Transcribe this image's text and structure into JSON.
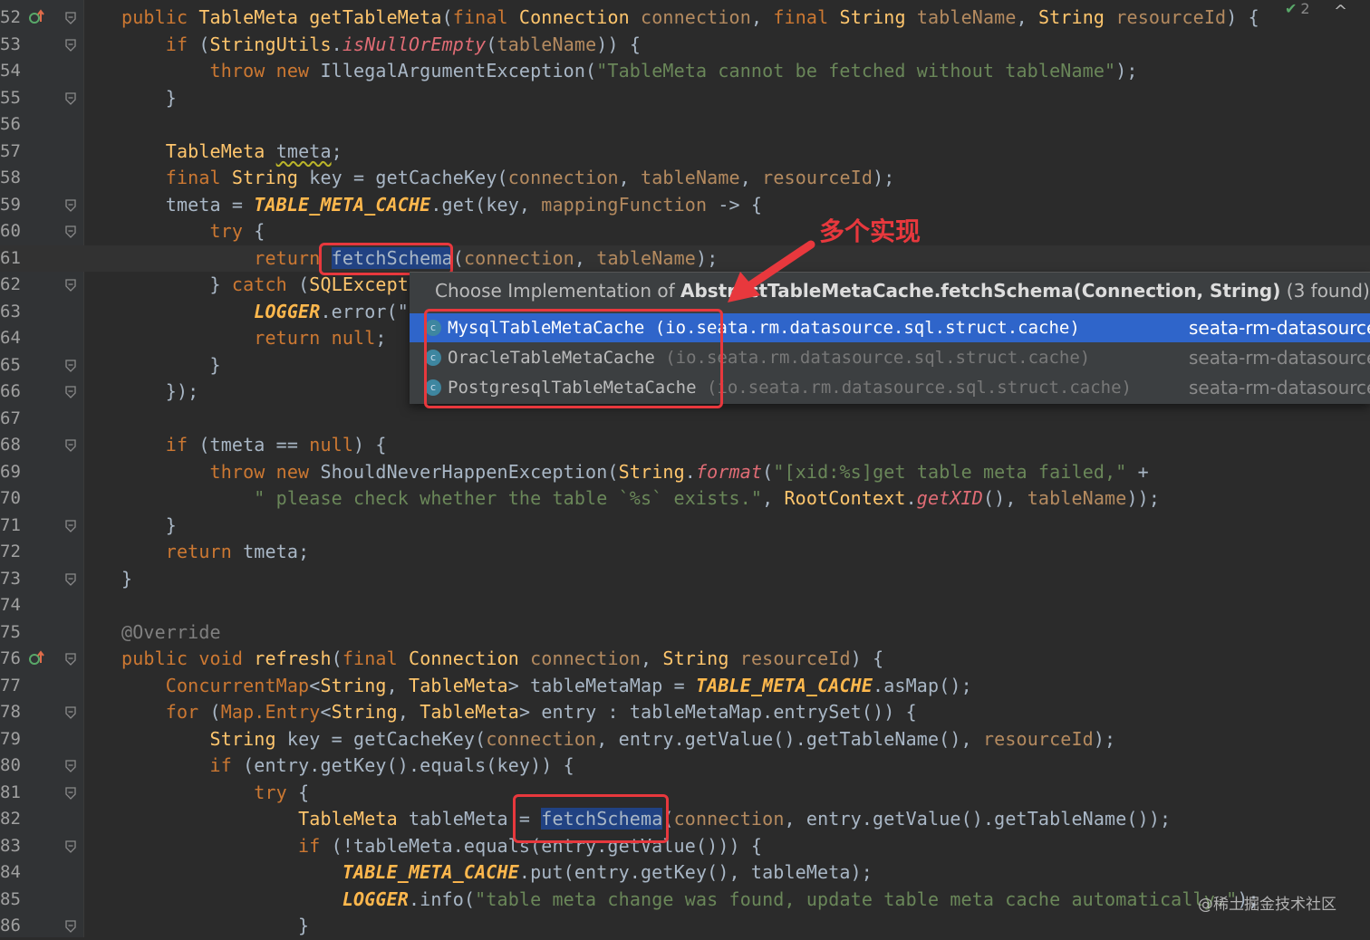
{
  "editor": {
    "lines": [
      {
        "num": "52",
        "marker": "override-up",
        "tokens": [
          [
            "public ",
            "kw"
          ],
          [
            "TableMeta ",
            "type"
          ],
          [
            "getTableMeta",
            "fn"
          ],
          [
            "(",
            "p"
          ],
          [
            "final ",
            "kw"
          ],
          [
            "Connection ",
            "type"
          ],
          [
            "connection",
            "param"
          ],
          [
            ", ",
            "p"
          ],
          [
            "final ",
            "kw"
          ],
          [
            "String ",
            "type"
          ],
          [
            "tableName",
            "param"
          ],
          [
            ", ",
            "p"
          ],
          [
            "String ",
            "type"
          ],
          [
            "resourceId",
            "param"
          ],
          [
            ") {",
            "p"
          ]
        ]
      },
      {
        "num": "53",
        "tokens": [
          [
            "    if ",
            "kw"
          ],
          [
            "(",
            "p"
          ],
          [
            "StringUtils",
            "type"
          ],
          [
            ".",
            "p"
          ],
          [
            "isNullOrEmpty",
            "staticm"
          ],
          [
            "(",
            "p"
          ],
          [
            "tableName",
            "param"
          ],
          [
            ")) {",
            "p"
          ]
        ]
      },
      {
        "num": "54",
        "tokens": [
          [
            "        throw new ",
            "kw"
          ],
          [
            "IllegalArgumentException(",
            "p"
          ],
          [
            "\"TableMeta cannot be fetched without tableName\"",
            "str"
          ],
          [
            ");",
            "p"
          ]
        ]
      },
      {
        "num": "55",
        "tokens": [
          [
            "    }",
            "p"
          ]
        ]
      },
      {
        "num": "56",
        "tokens": []
      },
      {
        "num": "57",
        "tokens": [
          [
            "    ",
            "p"
          ],
          [
            "TableMeta ",
            "type"
          ],
          [
            "tmeta",
            "sq"
          ],
          [
            ";",
            "p"
          ]
        ]
      },
      {
        "num": "58",
        "tokens": [
          [
            "    final ",
            "kw"
          ],
          [
            "String ",
            "type"
          ],
          [
            "key = getCacheKey(",
            "p"
          ],
          [
            "connection",
            "param"
          ],
          [
            ", ",
            "p"
          ],
          [
            "tableName",
            "param"
          ],
          [
            ", ",
            "p"
          ],
          [
            "resourceId",
            "param"
          ],
          [
            ");",
            "p"
          ]
        ]
      },
      {
        "num": "59",
        "tokens": [
          [
            "    tmeta = ",
            "p"
          ],
          [
            "TABLE_META_CACHE",
            "staticfld"
          ],
          [
            ".get(key, ",
            "p"
          ],
          [
            "mappingFunction",
            "param"
          ],
          [
            " -> {",
            "p"
          ]
        ]
      },
      {
        "num": "60",
        "tokens": [
          [
            "        try ",
            "kw"
          ],
          [
            "{",
            "p"
          ]
        ]
      },
      {
        "num": "61",
        "current": true,
        "tokens": [
          [
            "            return ",
            "kw"
          ],
          [
            "fetchSchema",
            "sel"
          ],
          [
            "(",
            "p"
          ],
          [
            "connection",
            "param"
          ],
          [
            ", ",
            "p"
          ],
          [
            "tableName",
            "param"
          ],
          [
            ");",
            "p"
          ]
        ]
      },
      {
        "num": "62",
        "tokens": [
          [
            "        } ",
            "p"
          ],
          [
            "catch ",
            "kw"
          ],
          [
            "(",
            "p"
          ],
          [
            "SQLExcepti",
            "type"
          ]
        ]
      },
      {
        "num": "63",
        "tokens": [
          [
            "            ",
            "p"
          ],
          [
            "LOGGER",
            "staticfld"
          ],
          [
            ".error(\"g",
            "p"
          ]
        ]
      },
      {
        "num": "64",
        "tokens": [
          [
            "            return null",
            "kw"
          ],
          [
            ";",
            "p"
          ]
        ]
      },
      {
        "num": "65",
        "tokens": [
          [
            "        }",
            "p"
          ]
        ]
      },
      {
        "num": "66",
        "tokens": [
          [
            "    });",
            "p"
          ]
        ]
      },
      {
        "num": "67",
        "tokens": []
      },
      {
        "num": "68",
        "tokens": [
          [
            "    if ",
            "kw"
          ],
          [
            "(tmeta == ",
            "p"
          ],
          [
            "null",
            "kw"
          ],
          [
            ") {",
            "p"
          ]
        ]
      },
      {
        "num": "69",
        "tokens": [
          [
            "        throw new ",
            "kw"
          ],
          [
            "ShouldNeverHappenException(",
            "p"
          ],
          [
            "String",
            "type"
          ],
          [
            ".",
            "p"
          ],
          [
            "format",
            "staticm"
          ],
          [
            "(",
            "p"
          ],
          [
            "\"[xid:%s]get table meta failed,\"",
            "str"
          ],
          [
            " +",
            "p"
          ]
        ]
      },
      {
        "num": "70",
        "tokens": [
          [
            "            ",
            "p"
          ],
          [
            "\" please check whether the table `%s` exists.\"",
            "str"
          ],
          [
            ", ",
            "p"
          ],
          [
            "RootContext",
            "type"
          ],
          [
            ".",
            "p"
          ],
          [
            "getXID",
            "staticm"
          ],
          [
            "(), ",
            "p"
          ],
          [
            "tableName",
            "param"
          ],
          [
            "));",
            "p"
          ]
        ]
      },
      {
        "num": "71",
        "tokens": [
          [
            "    }",
            "p"
          ]
        ]
      },
      {
        "num": "72",
        "tokens": [
          [
            "    return ",
            "kw"
          ],
          [
            "tmeta;",
            "p"
          ]
        ]
      },
      {
        "num": "73",
        "tokens": [
          [
            "}",
            "p"
          ]
        ]
      },
      {
        "num": "74",
        "tokens": []
      },
      {
        "num": "75",
        "tokens": [
          [
            "@Override",
            "anno"
          ]
        ]
      },
      {
        "num": "76",
        "marker": "override-up",
        "tokens": [
          [
            "public void ",
            "kw"
          ],
          [
            "refresh",
            "fn"
          ],
          [
            "(",
            "p"
          ],
          [
            "final ",
            "kw"
          ],
          [
            "Connection ",
            "type"
          ],
          [
            "connection",
            "param"
          ],
          [
            ", ",
            "p"
          ],
          [
            "String ",
            "type"
          ],
          [
            "resourceId",
            "param"
          ],
          [
            ") {",
            "p"
          ]
        ]
      },
      {
        "num": "77",
        "tokens": [
          [
            "    ConcurrentMap",
            "kw"
          ],
          [
            "<",
            "p"
          ],
          [
            "String",
            "type"
          ],
          [
            ", ",
            "p"
          ],
          [
            "TableMeta",
            "type"
          ],
          [
            "> tableMetaMap = ",
            "p"
          ],
          [
            "TABLE_META_CACHE",
            "staticfld"
          ],
          [
            ".asMap();",
            "p"
          ]
        ]
      },
      {
        "num": "78",
        "tokens": [
          [
            "    for ",
            "kw"
          ],
          [
            "(",
            "p"
          ],
          [
            "Map.Entry",
            "kw"
          ],
          [
            "<",
            "p"
          ],
          [
            "String",
            "type"
          ],
          [
            ", ",
            "p"
          ],
          [
            "TableMeta",
            "type"
          ],
          [
            "> entry : tableMetaMap.entrySet()) {",
            "p"
          ]
        ]
      },
      {
        "num": "79",
        "tokens": [
          [
            "        ",
            "p"
          ],
          [
            "String ",
            "type"
          ],
          [
            "key = getCacheKey(",
            "p"
          ],
          [
            "connection",
            "param"
          ],
          [
            ", entry.getValue().getTableName(), ",
            "p"
          ],
          [
            "resourceId",
            "param"
          ],
          [
            ");",
            "p"
          ]
        ]
      },
      {
        "num": "80",
        "tokens": [
          [
            "        if ",
            "kw"
          ],
          [
            "(entry.getKey().equals(key)) {",
            "p"
          ]
        ]
      },
      {
        "num": "81",
        "tokens": [
          [
            "            try ",
            "kw"
          ],
          [
            "{",
            "p"
          ]
        ]
      },
      {
        "num": "82",
        "tokens": [
          [
            "                ",
            "p"
          ],
          [
            "TableMeta ",
            "type"
          ],
          [
            "tableMeta = ",
            "p"
          ],
          [
            "fetchSchema",
            "sel"
          ],
          [
            "(",
            "p"
          ],
          [
            "connection",
            "param"
          ],
          [
            ", entry.getValue().getTableName());",
            "p"
          ]
        ]
      },
      {
        "num": "83",
        "tokens": [
          [
            "                if ",
            "kw"
          ],
          [
            "(!tableMeta.equals(entry.getValue())) {",
            "p"
          ]
        ]
      },
      {
        "num": "84",
        "tokens": [
          [
            "                    ",
            "p"
          ],
          [
            "TABLE_META_CACHE",
            "staticfld"
          ],
          [
            ".put(entry.getKey(), tableMeta);",
            "p"
          ]
        ]
      },
      {
        "num": "85",
        "tokens": [
          [
            "                    ",
            "p"
          ],
          [
            "LOGGER",
            "staticfld"
          ],
          [
            ".info(",
            "p"
          ],
          [
            "\"table meta change was found, update table meta cache automatically.\"",
            "str"
          ],
          [
            ");",
            "p"
          ]
        ]
      },
      {
        "num": "86",
        "tokens": [
          [
            "                }",
            "p"
          ]
        ]
      }
    ]
  },
  "inspection": {
    "count": "2",
    "up_icon": "^",
    "check_icon": "✔"
  },
  "annotation": {
    "text": "多个实现"
  },
  "popup": {
    "title_prefix": "Choose Implementation of ",
    "title_bold": "AbstractTableMetaCache.fetchSchema(Connection, String)",
    "title_suffix": " (3 found)",
    "items": [
      {
        "class": "MysqlTableMetaCache",
        "package": " (io.seata.rm.datasource.sql.struct.cache)",
        "module": "seata-rm-datasource",
        "icon": "c",
        "selected": true
      },
      {
        "class": "OracleTableMetaCache",
        "package": " (io.seata.rm.datasource.sql.struct.cache)",
        "module": "seata-rm-datasource",
        "icon": "c",
        "selected": false
      },
      {
        "class": "PostgresqlTableMetaCache",
        "package": " (io.seata.rm.datasource.sql.struct.cache)",
        "module": "seata-rm-datasource",
        "icon": "c",
        "selected": false
      }
    ]
  },
  "watermark": {
    "text": "@稀土掘金技术社区"
  }
}
